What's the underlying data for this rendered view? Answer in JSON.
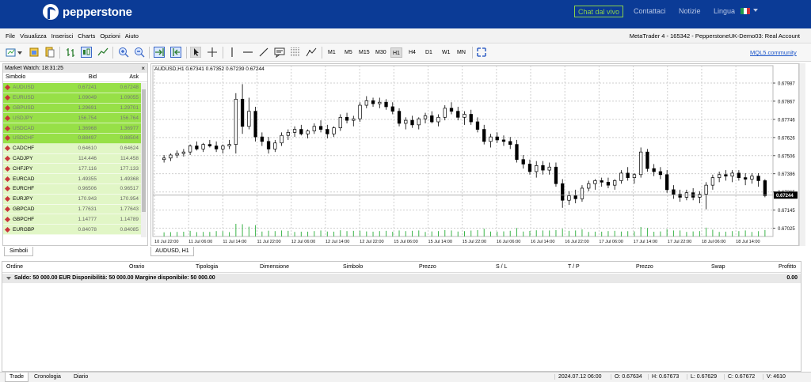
{
  "top": {
    "brand": "pepperstone",
    "chat_label": "Chat dal vivo",
    "links": [
      "Contattaci",
      "Notizie",
      "Lingua"
    ]
  },
  "menu": {
    "items": [
      "File",
      "Visualizza",
      "Inserisci",
      "Charts",
      "Opzioni",
      "Aiuto"
    ],
    "account": "MetaTrader 4 - 165342 - PepperstoneUK-Demo03: Real Account"
  },
  "toolbar": {
    "timeframes": [
      "M1",
      "M5",
      "M15",
      "M30",
      "H1",
      "H4",
      "D1",
      "W1",
      "MN"
    ],
    "active_timeframe": "H1",
    "mql5": "MQL5.community"
  },
  "market_watch": {
    "title": "Market Watch: 18:31:25",
    "col_symbol": "Simbolo",
    "col_bid": "Bid",
    "col_ask": "Ask",
    "rows": [
      {
        "symbol": "AUDUSD",
        "bid": "0.67241",
        "ask": "0.67248",
        "style": "hl"
      },
      {
        "symbol": "EURUSD",
        "bid": "1.09049",
        "ask": "1.09055",
        "style": "hl"
      },
      {
        "symbol": "GBPUSD",
        "bid": "1.29691",
        "ask": "1.29701",
        "style": "hl"
      },
      {
        "symbol": "USDJPY",
        "bid": "156.754",
        "ask": "156.764",
        "style": "hl"
      },
      {
        "symbol": "USDCAD",
        "bid": "1.36968",
        "ask": "1.36977",
        "style": "hl"
      },
      {
        "symbol": "USDCHF",
        "bid": "0.88497",
        "ask": "0.88504",
        "style": "hl"
      },
      {
        "symbol": "CADCHF",
        "bid": "0.64610",
        "ask": "0.64624",
        "style": "lt"
      },
      {
        "symbol": "CADJPY",
        "bid": "114.446",
        "ask": "114.458",
        "style": "lt"
      },
      {
        "symbol": "CHFJPY",
        "bid": "177.116",
        "ask": "177.133",
        "style": "lt"
      },
      {
        "symbol": "EURCAD",
        "bid": "1.49355",
        "ask": "1.49368",
        "style": "lt"
      },
      {
        "symbol": "EURCHF",
        "bid": "0.96506",
        "ask": "0.96517",
        "style": "lt"
      },
      {
        "symbol": "EURJPY",
        "bid": "170.943",
        "ask": "170.954",
        "style": "lt"
      },
      {
        "symbol": "GBPCAD",
        "bid": "1.77631",
        "ask": "1.77643",
        "style": "lt"
      },
      {
        "symbol": "GBPCHF",
        "bid": "1.14777",
        "ask": "1.14789",
        "style": "lt"
      },
      {
        "symbol": "EURGBP",
        "bid": "0.84078",
        "ask": "0.84085",
        "style": "lt"
      }
    ],
    "tab_label": "Simboli"
  },
  "chart": {
    "info": "AUDUSD,H1  0.67341 0.67352 0.67239 0.67244",
    "tab_label": "AUDUSD, H1",
    "y_ticks": [
      "0.67987",
      "0.67867",
      "0.67746",
      "0.67626",
      "0.67506",
      "0.67386",
      "0.67265",
      "0.67145",
      "0.67025"
    ],
    "y_values": [
      0.67987,
      0.67867,
      0.67746,
      0.67626,
      0.67506,
      0.67386,
      0.67265,
      0.67145,
      0.67025
    ],
    "current_price": "0.67244",
    "x_ticks": [
      "10 Jul 22:00",
      "11 Jul 06:00",
      "11 Jul 14:00",
      "11 Jul 22:00",
      "12 Jul 06:00",
      "12 Jul 14:00",
      "12 Jul 22:00",
      "15 Jul 06:00",
      "15 Jul 14:00",
      "15 Jul 22:00",
      "16 Jul 06:00",
      "16 Jul 14:00",
      "16 Jul 22:00",
      "17 Jul 06:00",
      "17 Jul 14:00",
      "17 Jul 22:00",
      "18 Jul 06:00",
      "18 Jul 14:00"
    ],
    "candles": [
      [
        0.6748,
        0.6751,
        0.6746,
        0.6749
      ],
      [
        0.6749,
        0.6752,
        0.6747,
        0.6751
      ],
      [
        0.6751,
        0.6754,
        0.6749,
        0.6752
      ],
      [
        0.6752,
        0.6755,
        0.675,
        0.6753
      ],
      [
        0.6753,
        0.6758,
        0.6751,
        0.6757
      ],
      [
        0.6757,
        0.676,
        0.6754,
        0.6755
      ],
      [
        0.6755,
        0.6759,
        0.6753,
        0.6758
      ],
      [
        0.6758,
        0.6761,
        0.6756,
        0.6757
      ],
      [
        0.6757,
        0.676,
        0.6753,
        0.6755
      ],
      [
        0.6755,
        0.6758,
        0.6752,
        0.6757
      ],
      [
        0.6757,
        0.6761,
        0.6755,
        0.6758
      ],
      [
        0.6758,
        0.6792,
        0.6752,
        0.6788
      ],
      [
        0.6788,
        0.6798,
        0.6765,
        0.677
      ],
      [
        0.677,
        0.6789,
        0.6768,
        0.678
      ],
      [
        0.678,
        0.6783,
        0.676,
        0.6763
      ],
      [
        0.6763,
        0.6766,
        0.6757,
        0.676
      ],
      [
        0.676,
        0.6763,
        0.6752,
        0.6755
      ],
      [
        0.6755,
        0.6761,
        0.6753,
        0.6759
      ],
      [
        0.6759,
        0.6766,
        0.6757,
        0.6764
      ],
      [
        0.6764,
        0.6768,
        0.6761,
        0.6766
      ],
      [
        0.6766,
        0.677,
        0.6763,
        0.6768
      ],
      [
        0.6768,
        0.6771,
        0.6764,
        0.6765
      ],
      [
        0.6765,
        0.6768,
        0.6762,
        0.6767
      ],
      [
        0.6767,
        0.6772,
        0.6765,
        0.677
      ],
      [
        0.677,
        0.6774,
        0.6766,
        0.6768
      ],
      [
        0.6768,
        0.6771,
        0.6762,
        0.6765
      ],
      [
        0.6765,
        0.677,
        0.6763,
        0.6769
      ],
      [
        0.6769,
        0.6778,
        0.6767,
        0.6776
      ],
      [
        0.6776,
        0.6779,
        0.6772,
        0.6774
      ],
      [
        0.6774,
        0.6777,
        0.677,
        0.6775
      ],
      [
        0.6775,
        0.6786,
        0.6773,
        0.6784
      ],
      [
        0.6784,
        0.679,
        0.6782,
        0.6787
      ],
      [
        0.6787,
        0.6789,
        0.6783,
        0.6785
      ],
      [
        0.6785,
        0.6789,
        0.6782,
        0.6786
      ],
      [
        0.6786,
        0.6788,
        0.6781,
        0.6783
      ],
      [
        0.6783,
        0.6786,
        0.6778,
        0.678
      ],
      [
        0.678,
        0.6782,
        0.677,
        0.6772
      ],
      [
        0.6772,
        0.6776,
        0.6768,
        0.6774
      ],
      [
        0.6774,
        0.6777,
        0.6769,
        0.6771
      ],
      [
        0.6771,
        0.6776,
        0.6768,
        0.6775
      ],
      [
        0.6775,
        0.6779,
        0.6772,
        0.6777
      ],
      [
        0.6777,
        0.678,
        0.6772,
        0.6773
      ],
      [
        0.6773,
        0.6778,
        0.677,
        0.6776
      ],
      [
        0.6776,
        0.6784,
        0.6774,
        0.6782
      ],
      [
        0.6782,
        0.6786,
        0.6778,
        0.678
      ],
      [
        0.678,
        0.6783,
        0.6774,
        0.6776
      ],
      [
        0.6776,
        0.678,
        0.6771,
        0.6778
      ],
      [
        0.6778,
        0.6781,
        0.6771,
        0.6773
      ],
      [
        0.6773,
        0.6776,
        0.6766,
        0.6768
      ],
      [
        0.6768,
        0.6771,
        0.6758,
        0.676
      ],
      [
        0.676,
        0.6765,
        0.6756,
        0.6763
      ],
      [
        0.6763,
        0.6766,
        0.6759,
        0.6761
      ],
      [
        0.6761,
        0.6764,
        0.6757,
        0.676
      ],
      [
        0.676,
        0.6763,
        0.6755,
        0.6758
      ],
      [
        0.6758,
        0.6761,
        0.6746,
        0.6748
      ],
      [
        0.6748,
        0.6751,
        0.6742,
        0.6745
      ],
      [
        0.6745,
        0.6748,
        0.6738,
        0.674
      ],
      [
        0.674,
        0.6747,
        0.6736,
        0.6744
      ],
      [
        0.6744,
        0.6747,
        0.6738,
        0.6741
      ],
      [
        0.6741,
        0.6746,
        0.6738,
        0.6743
      ],
      [
        0.6743,
        0.6746,
        0.673,
        0.6732
      ],
      [
        0.6732,
        0.6735,
        0.6716,
        0.6721
      ],
      [
        0.6721,
        0.6727,
        0.6718,
        0.6724
      ],
      [
        0.6724,
        0.6728,
        0.6719,
        0.6722
      ],
      [
        0.6722,
        0.6731,
        0.672,
        0.6729
      ],
      [
        0.6729,
        0.6734,
        0.6727,
        0.6732
      ],
      [
        0.6732,
        0.6735,
        0.6728,
        0.6734
      ],
      [
        0.6734,
        0.6736,
        0.673,
        0.6733
      ],
      [
        0.6733,
        0.6736,
        0.6729,
        0.6731
      ],
      [
        0.6731,
        0.6735,
        0.6728,
        0.6734
      ],
      [
        0.6734,
        0.6741,
        0.6732,
        0.6739
      ],
      [
        0.6739,
        0.6743,
        0.6734,
        0.6736
      ],
      [
        0.6736,
        0.6739,
        0.6732,
        0.6738
      ],
      [
        0.6738,
        0.6756,
        0.6736,
        0.6753
      ],
      [
        0.6753,
        0.6755,
        0.674,
        0.6742
      ],
      [
        0.6742,
        0.6745,
        0.6737,
        0.674
      ],
      [
        0.674,
        0.6743,
        0.6735,
        0.6738
      ],
      [
        0.6738,
        0.6741,
        0.6726,
        0.6728
      ],
      [
        0.6728,
        0.6731,
        0.6722,
        0.6725
      ],
      [
        0.6725,
        0.6728,
        0.672,
        0.6723
      ],
      [
        0.6723,
        0.6728,
        0.6721,
        0.6726
      ],
      [
        0.6726,
        0.6729,
        0.6721,
        0.6723
      ],
      [
        0.6723,
        0.6727,
        0.6719,
        0.6725
      ],
      [
        0.6725,
        0.6733,
        0.6715,
        0.6731
      ],
      [
        0.6731,
        0.6738,
        0.6728,
        0.6736
      ],
      [
        0.6736,
        0.674,
        0.6733,
        0.6738
      ],
      [
        0.6738,
        0.6741,
        0.6734,
        0.6737
      ],
      [
        0.6737,
        0.6741,
        0.6733,
        0.6739
      ],
      [
        0.6739,
        0.6741,
        0.6734,
        0.6736
      ],
      [
        0.6736,
        0.6739,
        0.6731,
        0.6735
      ],
      [
        0.6735,
        0.6739,
        0.6732,
        0.6737
      ],
      [
        0.6737,
        0.6739,
        0.673,
        0.6734
      ],
      [
        0.6734,
        0.6735,
        0.6723,
        0.6724
      ]
    ],
    "y_min": 0.6697,
    "y_max": 0.6805
  },
  "terminal": {
    "headers": [
      "Ordine",
      "Orario",
      "Tipologia",
      "Dimensione",
      "Simbolo",
      "Prezzo",
      "S / L",
      "T / P",
      "Prezzo",
      "Swap",
      "Profitto"
    ],
    "balance_line": "Saldo: 50 000.00 EUR  Disponibilità: 50 000.00  Margine disponibile: 50 000.00",
    "profit": "0.00"
  },
  "status": {
    "tabs": [
      "Trade",
      "Cronologia",
      "Diario"
    ],
    "fields": [
      "2024.07.12 06:00",
      "O: 0.67634",
      "H: 0.67673",
      "L: 0.67629",
      "C: 0.67672",
      "V: 4610"
    ]
  }
}
